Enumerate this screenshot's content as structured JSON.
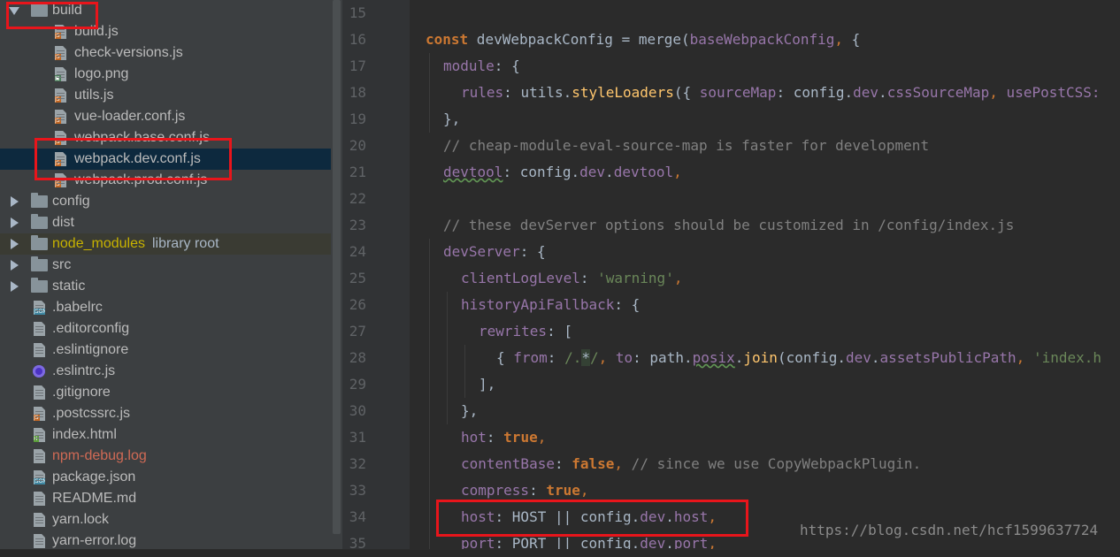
{
  "project_tree": {
    "items": [
      {
        "label": "build",
        "kind": "folder",
        "expanded": true
      },
      {
        "label": "build.js",
        "kind": "js"
      },
      {
        "label": "check-versions.js",
        "kind": "js"
      },
      {
        "label": "logo.png",
        "kind": "image"
      },
      {
        "label": "utils.js",
        "kind": "js"
      },
      {
        "label": "vue-loader.conf.js",
        "kind": "js"
      },
      {
        "label": "webpack.base.conf.js",
        "kind": "js"
      },
      {
        "label": "webpack.dev.conf.js",
        "kind": "js",
        "selected": true
      },
      {
        "label": "webpack.prod.conf.js",
        "kind": "js"
      },
      {
        "label": "config",
        "kind": "folder"
      },
      {
        "label": "dist",
        "kind": "folder"
      },
      {
        "label": "node_modules",
        "kind": "folder",
        "extra": "library root"
      },
      {
        "label": "src",
        "kind": "folder"
      },
      {
        "label": "static",
        "kind": "folder"
      },
      {
        "label": ".babelrc",
        "kind": "json"
      },
      {
        "label": ".editorconfig",
        "kind": "text"
      },
      {
        "label": ".eslintignore",
        "kind": "text"
      },
      {
        "label": ".eslintrc.js",
        "kind": "eslint"
      },
      {
        "label": ".gitignore",
        "kind": "text"
      },
      {
        "label": ".postcssrc.js",
        "kind": "js"
      },
      {
        "label": "index.html",
        "kind": "html"
      },
      {
        "label": "npm-debug.log",
        "kind": "text"
      },
      {
        "label": "package.json",
        "kind": "json"
      },
      {
        "label": "README.md",
        "kind": "text"
      },
      {
        "label": "yarn.lock",
        "kind": "text"
      },
      {
        "label": "yarn-error.log",
        "kind": "text"
      }
    ]
  },
  "editor": {
    "line_numbers": [
      "15",
      "16",
      "17",
      "18",
      "19",
      "20",
      "21",
      "22",
      "23",
      "24",
      "25",
      "26",
      "27",
      "28",
      "29",
      "30",
      "31",
      "32",
      "33",
      "34",
      "35"
    ],
    "l16": {
      "kw": "const",
      "a": " devWebpackConfig = merge(",
      "b": "baseWebpackConfig",
      "c": ",",
      "d": " {"
    },
    "l17": {
      "a": "module",
      "b": ": {"
    },
    "l18": {
      "a": "rules",
      "b": ": utils.",
      "c": "styleLoaders",
      "d": "({ ",
      "e": "sourceMap",
      "f": ": config.",
      "g": "dev",
      "h": ".",
      "i": "cssSourceMap",
      "j": ",",
      "k": " usePostCSS:"
    },
    "l19": {
      "a": "},"
    },
    "l20": {
      "a": "// cheap-module-eval-source-map is faster for development"
    },
    "l21": {
      "a": "devtool",
      "b": ": config.",
      "c": "dev",
      "d": ".",
      "e": "devtool",
      "f": ","
    },
    "l23": {
      "a": "// these devServer options should be customized in /config/index.js"
    },
    "l24": {
      "a": "devServer",
      "b": ": {"
    },
    "l25": {
      "a": "clientLogLevel",
      "b": ": ",
      "c": "'warning'",
      "d": ","
    },
    "l26": {
      "a": "historyApiFallback",
      "b": ": {"
    },
    "l27": {
      "a": "rewrites",
      "b": ": ["
    },
    "l28": {
      "a": "{ ",
      "b": "from",
      "c": ": ",
      "d": "/.",
      "e": "*",
      "f": "/",
      "g": ",",
      "h": " ",
      "i": "to",
      "j": ": path.",
      "k": "posix",
      "l": ".",
      "m": "join",
      "n": "(config.",
      "o": "dev",
      "p": ".",
      "q": "assetsPublicPath",
      "r": ",",
      "s": " ",
      "t": "'index.h"
    },
    "l29": {
      "a": "],"
    },
    "l30": {
      "a": "},"
    },
    "l31": {
      "a": "hot",
      "b": ": ",
      "c": "true",
      "d": ","
    },
    "l32": {
      "a": "contentBase",
      "b": ": ",
      "c": "false",
      "d": ",",
      "e": " // since we use CopyWebpackPlugin."
    },
    "l33": {
      "a": "compress",
      "b": ": ",
      "c": "true",
      "d": ","
    },
    "l34": {
      "a": "host",
      "b": ": HOST || config.",
      "c": "dev",
      "d": ".",
      "e": "host",
      "f": ","
    },
    "l35": {
      "a": "port",
      "b": ": PORT || config.",
      "c": "dev",
      "d": ".",
      "e": "port",
      "f": ","
    }
  },
  "watermark": "https://blog.csdn.net/hcf1599637724",
  "colors": {
    "highlight_box": "#e8151b",
    "selection": "#0d293e",
    "keyword": "#cc7832",
    "property": "#9876aa",
    "string": "#6a8759",
    "comment": "#808080",
    "function": "#ffc66d"
  }
}
